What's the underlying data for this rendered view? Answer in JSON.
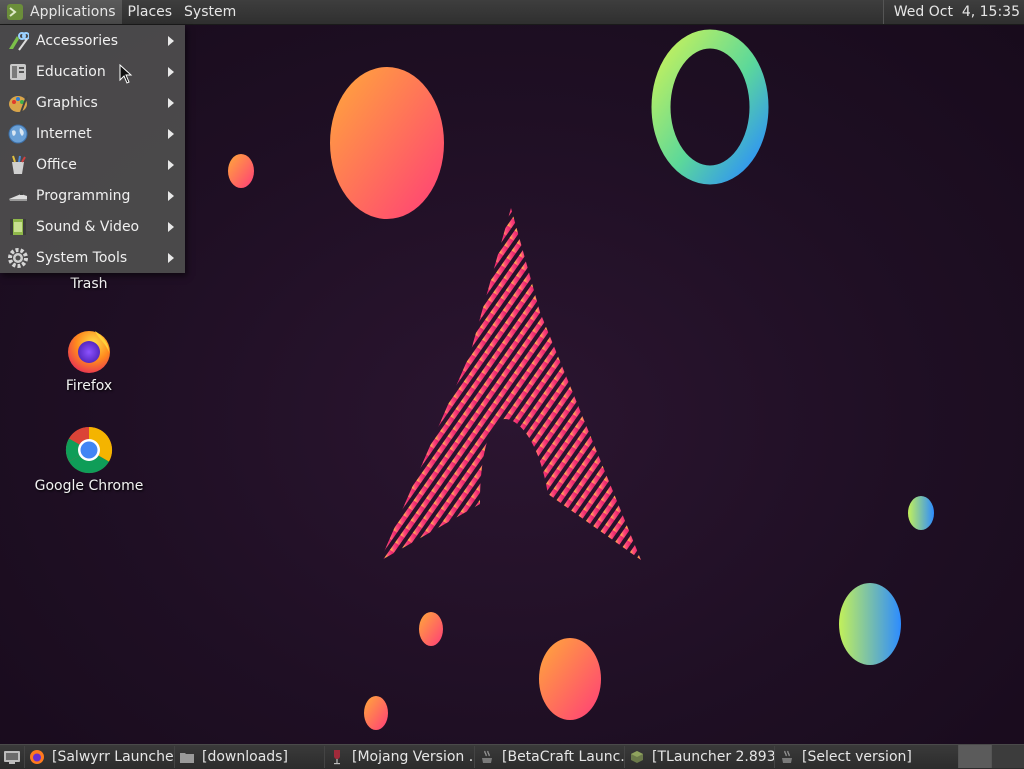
{
  "top_panel": {
    "menus": [
      {
        "label": "Applications",
        "icon": "mate-logo-icon"
      },
      {
        "label": "Places"
      },
      {
        "label": "System"
      }
    ],
    "clock": "Wed Oct  4, 15:35"
  },
  "apps_menu": {
    "items": [
      {
        "label": "Accessories",
        "icon": "accessories-icon"
      },
      {
        "label": "Education",
        "icon": "education-icon"
      },
      {
        "label": "Graphics",
        "icon": "graphics-icon"
      },
      {
        "label": "Internet",
        "icon": "internet-globe-icon"
      },
      {
        "label": "Office",
        "icon": "office-icon"
      },
      {
        "label": "Programming",
        "icon": "programming-icon"
      },
      {
        "label": "Sound & Video",
        "icon": "sound-video-icon"
      },
      {
        "label": "System Tools",
        "icon": "system-tools-gear-icon"
      }
    ]
  },
  "desktop": {
    "icons": [
      {
        "label": "Trash",
        "icon": "trash-icon"
      },
      {
        "label": "Firefox",
        "icon": "firefox-icon"
      },
      {
        "label": "Google Chrome",
        "icon": "chrome-icon"
      }
    ]
  },
  "taskbar": {
    "tasks": [
      {
        "label": "[Salwyrr Launche...",
        "icon": "firefox-icon"
      },
      {
        "label": "[downloads]",
        "icon": "folder-icon"
      },
      {
        "label": "[Mojang Version ...",
        "icon": "wine-icon"
      },
      {
        "label": "[BetaCraft Launc...",
        "icon": "java-icon"
      },
      {
        "label": "[TLauncher 2.893]",
        "icon": "tlauncher-icon"
      },
      {
        "label": "[Select version]",
        "icon": "java-icon"
      }
    ]
  },
  "colors": {
    "wallpaper_bg": "#1f0f24",
    "panel": "#333333",
    "menu_bg": "#4e4e4e",
    "accent_pink": "#ff3d7f",
    "accent_orange": "#ffa63a"
  }
}
